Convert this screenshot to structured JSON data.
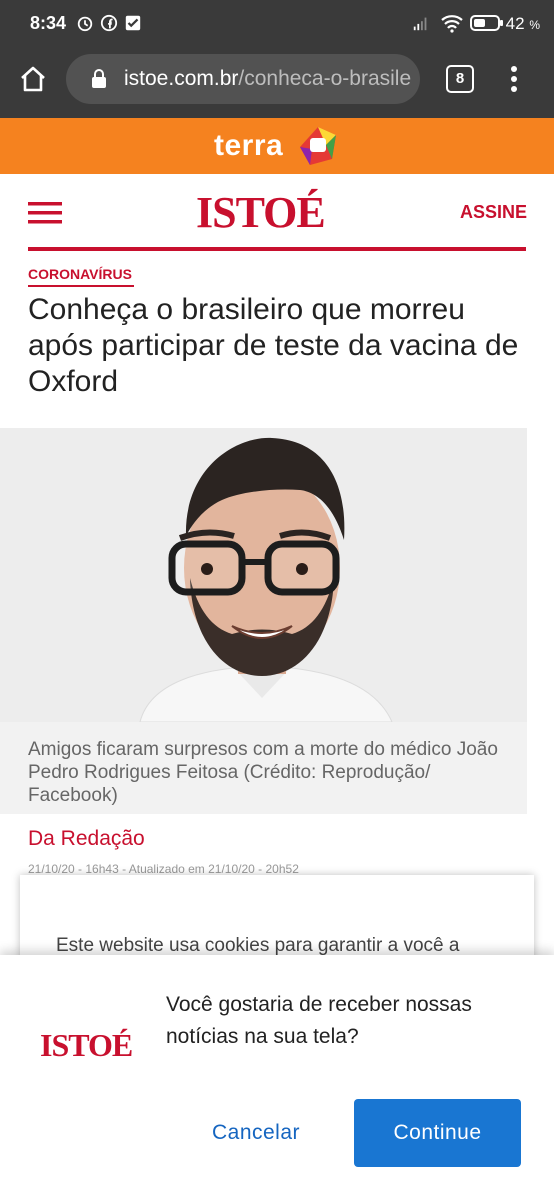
{
  "status_bar": {
    "time": "8:34",
    "battery_percent": "42",
    "battery_unit": "%",
    "icons": [
      "alarm-icon",
      "facebook-icon",
      "check-box-icon",
      "signal-icon",
      "wifi-icon",
      "battery-icon"
    ]
  },
  "browser": {
    "url_domain": "istoe.com.br",
    "url_path": "/conheca-o-brasile",
    "tab_count": "8"
  },
  "terra_banner": {
    "label": "terra"
  },
  "header": {
    "logo": "ISTOÉ",
    "subscribe": "ASSINE"
  },
  "article": {
    "category": "CORONAVÍRUS",
    "title": "Conheça o brasileiro que morreu após participar de teste da vacina de Oxford",
    "caption": "Amigos ficaram surpresos com a morte do médico João Pedro Rodrigues Feitosa (Crédito: Reprodução/ Facebook)",
    "author": "Da Redação",
    "date": "21/10/20 - 16h43 - Atualizado em 21/10/20 - 20h52"
  },
  "cookie_banner": {
    "text": "Este website usa cookies para garantir a você a"
  },
  "push_dialog": {
    "logo": "ISTOÉ",
    "question": "Você gostaria de receber nossas notícias na sua tela?",
    "cancel_label": "Cancelar",
    "continue_label": "Continue"
  },
  "colors": {
    "brand_red": "#c8102e",
    "terra_orange": "#f5821f",
    "primary_blue": "#1976d2"
  }
}
